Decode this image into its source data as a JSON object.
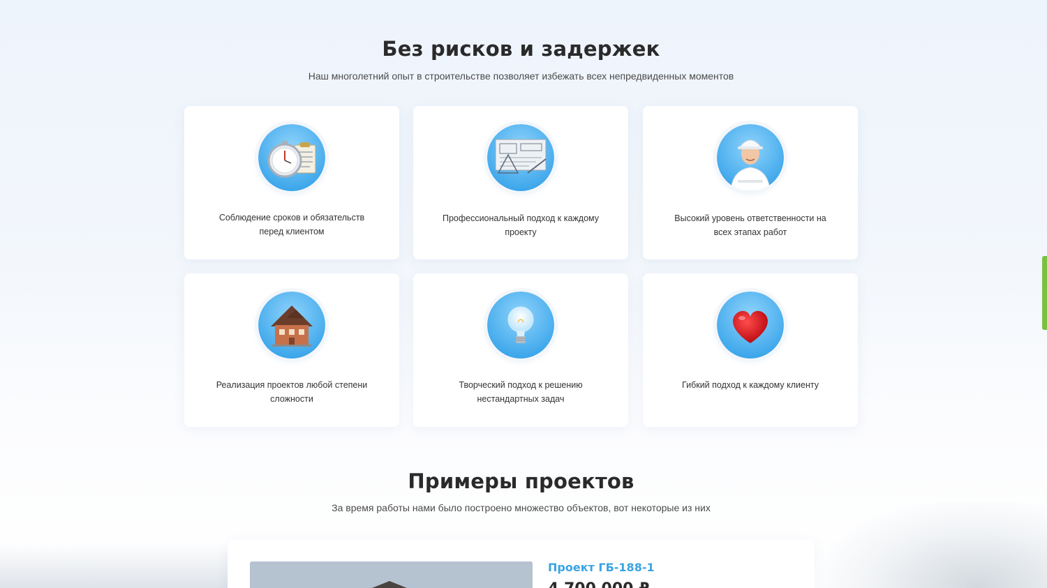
{
  "risks_section": {
    "title": "Без рисков и задержек",
    "subtitle": "Наш многолетний опыт в строительстве позволяет избежать всех непредвиденных моментов",
    "cards": [
      {
        "text": "Соблюдение сроков и обязательств перед клиентом",
        "icon": "stopwatch-checklist-icon"
      },
      {
        "text": "Профессиональный подход к каждому проекту",
        "icon": "blueprints-icon"
      },
      {
        "text": "Высокий уровень ответственности на всех этапах работ",
        "icon": "engineer-icon"
      },
      {
        "text": "Реализация проектов любой степени сложности",
        "icon": "house-icon"
      },
      {
        "text": "Творческий подход к решению нестандартных задач",
        "icon": "lightbulb-icon"
      },
      {
        "text": "Гибкий подход к каждому клиенту",
        "icon": "heart-icon"
      }
    ]
  },
  "projects_section": {
    "title": "Примеры проектов",
    "subtitle": "За время работы нами было построено множество объектов, вот некоторые из них",
    "project": {
      "title": "Проект ГБ-188-1",
      "price": "4 700 000 ₽"
    }
  },
  "colors": {
    "accent_blue": "#3aa3e3",
    "icon_circle_blue": "#4fb3ef",
    "scroll_green": "#7ac142"
  }
}
